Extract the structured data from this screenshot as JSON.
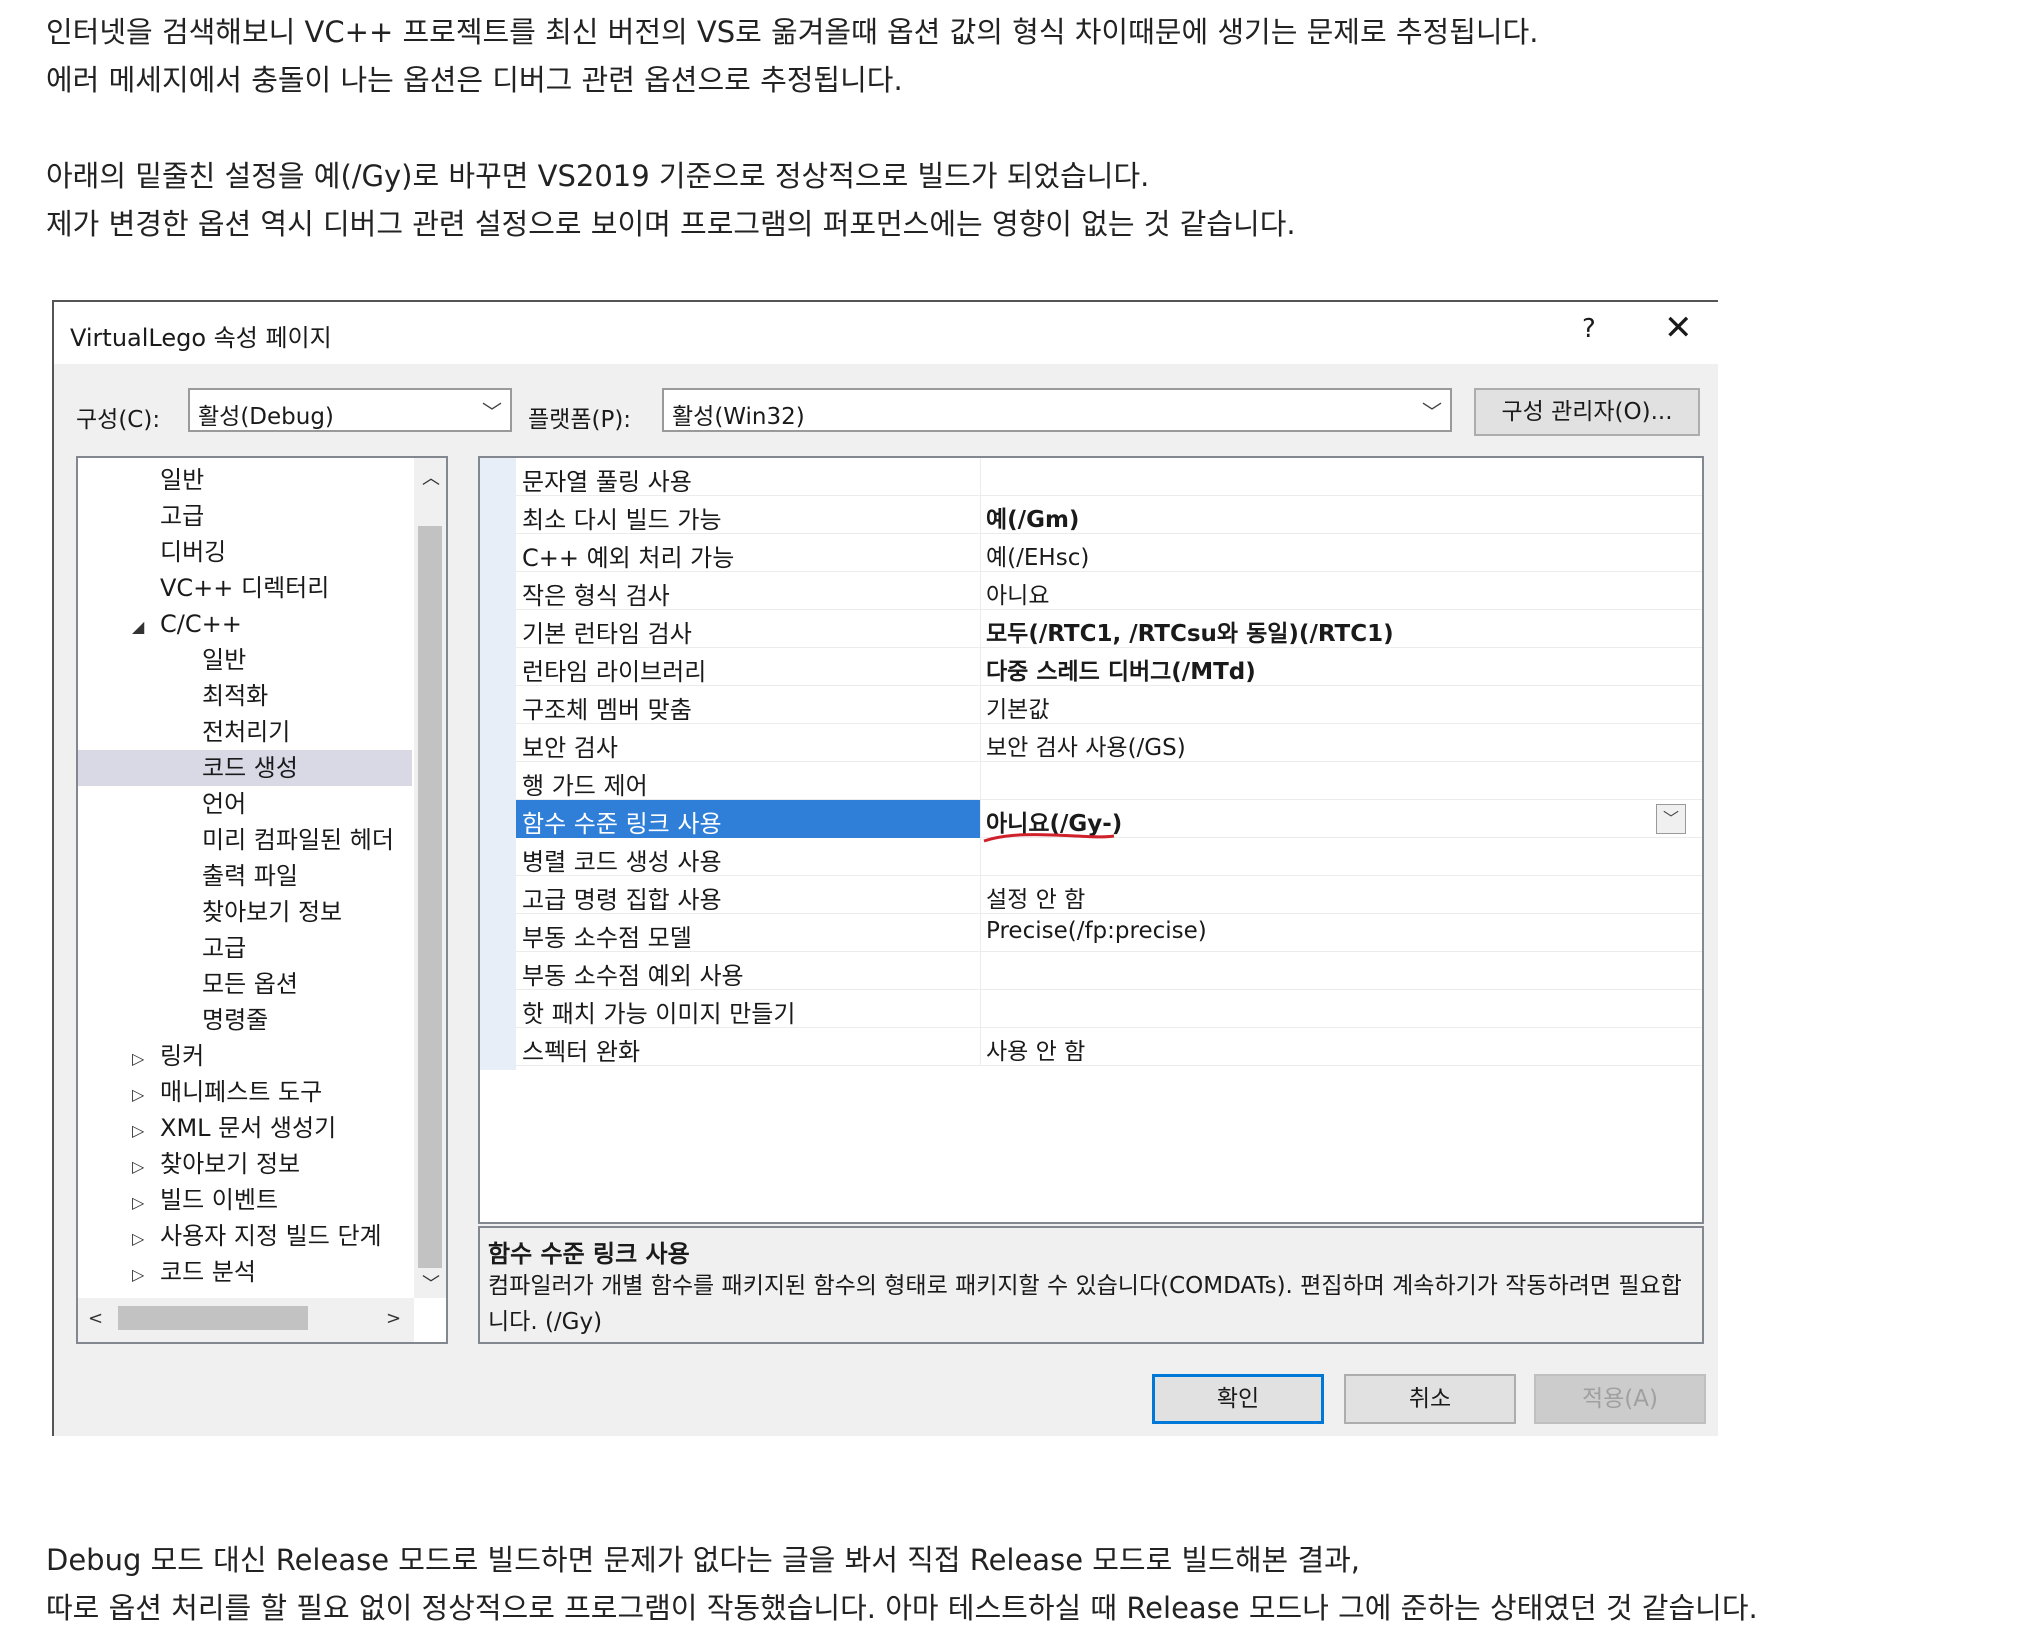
{
  "intro": {
    "lines": [
      "인터넷을 검색해보니 VC++ 프로젝트를 최신 버전의 VS로 옮겨올때 옵션 값의 형식 차이때문에 생기는 문제로 추정됩니다.",
      "에러 메세지에서 충돌이 나는 옵션은 디버그 관련 옵션으로 추정됩니다."
    ]
  },
  "change": {
    "lines": [
      "아래의 밑줄친 설정을 예(/Gy)로 바꾸면 VS2019 기준으로 정상적으로 빌드가 되었습니다.",
      "제가 변경한 옵션 역시 디버그 관련 설정으로 보이며 프로그램의 퍼포먼스에는 영향이 없는 것 같습니다."
    ]
  },
  "outro": {
    "lines": [
      "Debug 모드 대신 Release 모드로 빌드하면 문제가 없다는 글을 봐서 직접 Release 모드로 빌드해본 결과,",
      "따로 옵션 처리를 할 필요 없이 정상적으로 프로그램이 작동했습니다. 아마 테스트하실 때 Release 모드나 그에 준하는 상태였던 것 같습니다."
    ]
  },
  "dialog": {
    "title": "VirtualLego 속성 페이지",
    "help_label": "?",
    "close_label": "✕",
    "config_label": "구성(C):",
    "config_value": "활성(Debug)",
    "platform_label": "플랫폼(P):",
    "platform_value": "활성(Win32)",
    "config_manager_label": "구성 관리자(O)...",
    "ok_label": "확인",
    "cancel_label": "취소",
    "apply_label": "적용(A)"
  },
  "tree": {
    "items": [
      {
        "label": "일반",
        "arrow": ""
      },
      {
        "label": "고급",
        "arrow": ""
      },
      {
        "label": "디버깅",
        "arrow": ""
      },
      {
        "label": "VC++ 디렉터리",
        "arrow": ""
      },
      {
        "label": "C/C++",
        "arrow": "◢"
      },
      {
        "label": "일반",
        "arrow": ""
      },
      {
        "label": "최적화",
        "arrow": ""
      },
      {
        "label": "전처리기",
        "arrow": ""
      },
      {
        "label": "코드 생성",
        "arrow": ""
      },
      {
        "label": "언어",
        "arrow": ""
      },
      {
        "label": "미리 컴파일된 헤더",
        "arrow": ""
      },
      {
        "label": "출력 파일",
        "arrow": ""
      },
      {
        "label": "찾아보기 정보",
        "arrow": ""
      },
      {
        "label": "고급",
        "arrow": ""
      },
      {
        "label": "모든 옵션",
        "arrow": ""
      },
      {
        "label": "명령줄",
        "arrow": ""
      },
      {
        "label": "링커",
        "arrow": "▷"
      },
      {
        "label": "매니페스트 도구",
        "arrow": "▷"
      },
      {
        "label": "XML 문서 생성기",
        "arrow": "▷"
      },
      {
        "label": "찾아보기 정보",
        "arrow": "▷"
      },
      {
        "label": "빌드 이벤트",
        "arrow": "▷"
      },
      {
        "label": "사용자 지정 빌드 단계",
        "arrow": "▷"
      },
      {
        "label": "코드 분석",
        "arrow": "▷"
      }
    ],
    "selected_label": "코드 생성"
  },
  "scroll": {
    "up": "︿",
    "down": "﹀",
    "left": "<",
    "right": ">"
  },
  "properties": [
    {
      "name": "문자열 풀링 사용",
      "value": ""
    },
    {
      "name": "최소 다시 빌드 가능",
      "value": "예(/Gm)"
    },
    {
      "name": "C++ 예외 처리 가능",
      "value": "예(/EHsc)"
    },
    {
      "name": "작은 형식 검사",
      "value": "아니요"
    },
    {
      "name": "기본 런타임 검사",
      "value": "모두(/RTC1, /RTCsu와 동일)(/RTC1)"
    },
    {
      "name": "런타임 라이브러리",
      "value": "다중 스레드 디버그(/MTd)"
    },
    {
      "name": "구조체 멤버 맞춤",
      "value": "기본값"
    },
    {
      "name": "보안 검사",
      "value": "보안 검사 사용(/GS)"
    },
    {
      "name": "행 가드 제어",
      "value": ""
    },
    {
      "name": "함수 수준 링크 사용",
      "value": "아니요(/Gy-)"
    },
    {
      "name": "병렬 코드 생성 사용",
      "value": ""
    },
    {
      "name": "고급 명령 집합 사용",
      "value": "설정 안 함"
    },
    {
      "name": "부동 소수점 모델",
      "value": "Precise(/fp:precise)"
    },
    {
      "name": "부동 소수점 예외 사용",
      "value": ""
    },
    {
      "name": "핫 패치 가능 이미지 만들기",
      "value": ""
    },
    {
      "name": "스펙터 완화",
      "value": "사용 안 함"
    }
  ],
  "description": {
    "title": "함수 수준 링크 사용",
    "body": "컴파일러가 개별 함수를 패키지된 함수의 형태로 패키지할 수 있습니다(COMDATs). 편집하며 계속하기가 작동하려면 필요합니다.    (/Gy)"
  },
  "colors": {
    "selection": "#2f7ed8",
    "underline": "#d0202a",
    "primary_border": "#0078d7"
  }
}
